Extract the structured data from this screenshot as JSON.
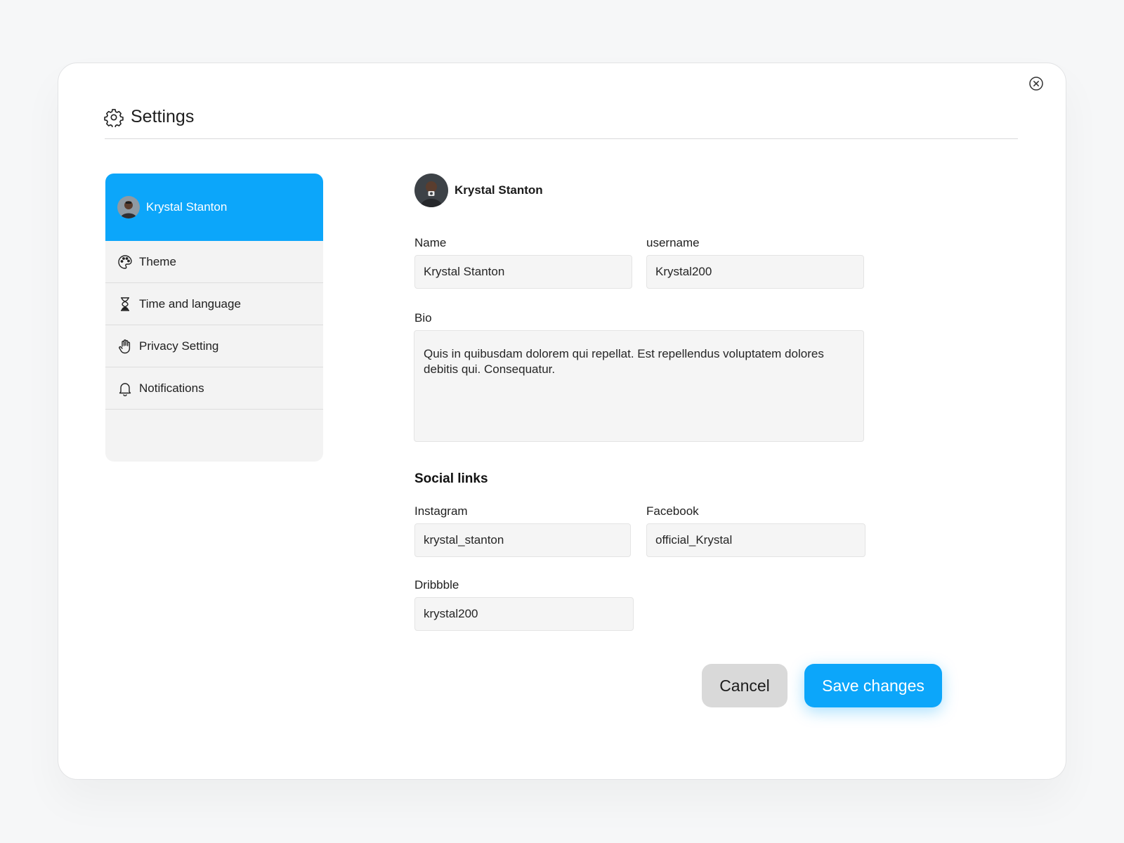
{
  "header": {
    "title": "Settings",
    "icon": "gear-icon"
  },
  "close_icon": "close-circle-icon",
  "sidebar": {
    "profile": {
      "name": "Krystal Stanton",
      "active_color": "#0ca6fa"
    },
    "items": [
      {
        "label": "Theme",
        "icon": "palette-icon"
      },
      {
        "label": "Time and language",
        "icon": "hourglass-icon"
      },
      {
        "label": "Privacy Setting",
        "icon": "hand-icon"
      },
      {
        "label": "Notifications",
        "icon": "bell-icon"
      }
    ]
  },
  "profile": {
    "name": "Krystal Stanton"
  },
  "form": {
    "name_label": "Name",
    "name_value": "Krystal Stanton",
    "username_label": "username",
    "username_value": "Krystal200",
    "bio_label": "Bio",
    "bio_value": "Quis in quibusdam dolorem qui repellat. Est repellendus voluptatem dolores debitis qui. Consequatur."
  },
  "social": {
    "title": "Social links",
    "instagram_label": "Instagram",
    "instagram_value": "krystal_stanton",
    "facebook_label": "Facebook",
    "facebook_value": "official_Krystal",
    "dribbble_label": "Dribbble",
    "dribbble_value": "krystal200"
  },
  "actions": {
    "cancel_label": "Cancel",
    "save_label": "Save changes"
  },
  "colors": {
    "accent": "#0ca6fa",
    "cancel_bg": "#d9d9d9"
  }
}
